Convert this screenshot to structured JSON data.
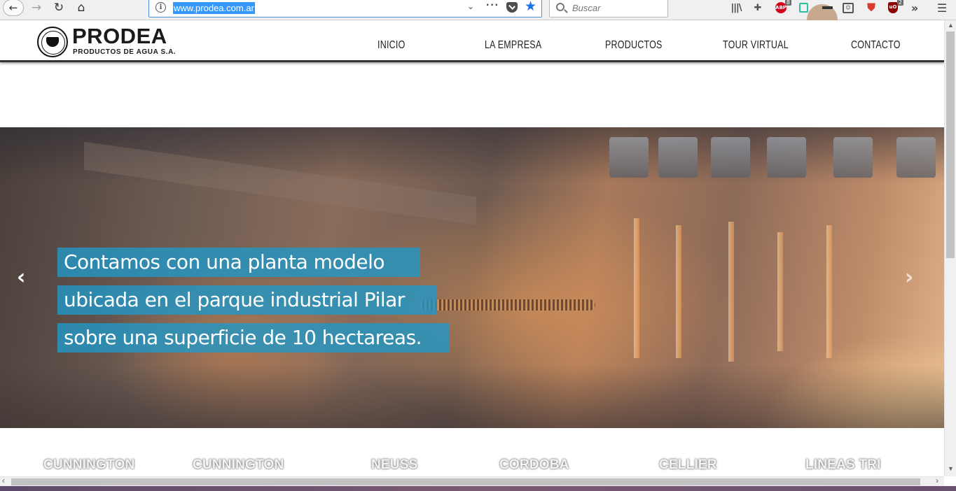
{
  "browser": {
    "url": "www.prodea.com.ar",
    "search_placeholder": "Buscar",
    "adblock_label": "ABP",
    "adblock_badge": "8",
    "ublock_label": "uO",
    "ublock_badge": "2"
  },
  "site": {
    "logo_name": "PRODEA",
    "logo_tagline": "PRODUCTOS DE AGUA S.A.",
    "nav": [
      {
        "label": "INICIO"
      },
      {
        "label": "LA EMPRESA"
      },
      {
        "label": "PRODUCTOS"
      },
      {
        "label": "TOUR VIRTUAL"
      },
      {
        "label": "CONTACTO"
      }
    ]
  },
  "hero": {
    "captions": [
      "Contamos con una planta modelo",
      "ubicada en el parque industrial Pilar",
      "sobre una superficie de 10 hectareas."
    ],
    "caption_color": "#2396c3"
  },
  "products": [
    "CUNNINGTON",
    "CUNNINGTON",
    "NEUSS",
    "CORDOBA",
    "CELLIER",
    "LINEAS TRI"
  ],
  "icons": {
    "back": "back-arrow-icon",
    "forward": "forward-arrow-icon",
    "reload": "reload-icon",
    "home": "home-icon",
    "bookmark": "star-icon",
    "menu": "hamburger-icon"
  }
}
